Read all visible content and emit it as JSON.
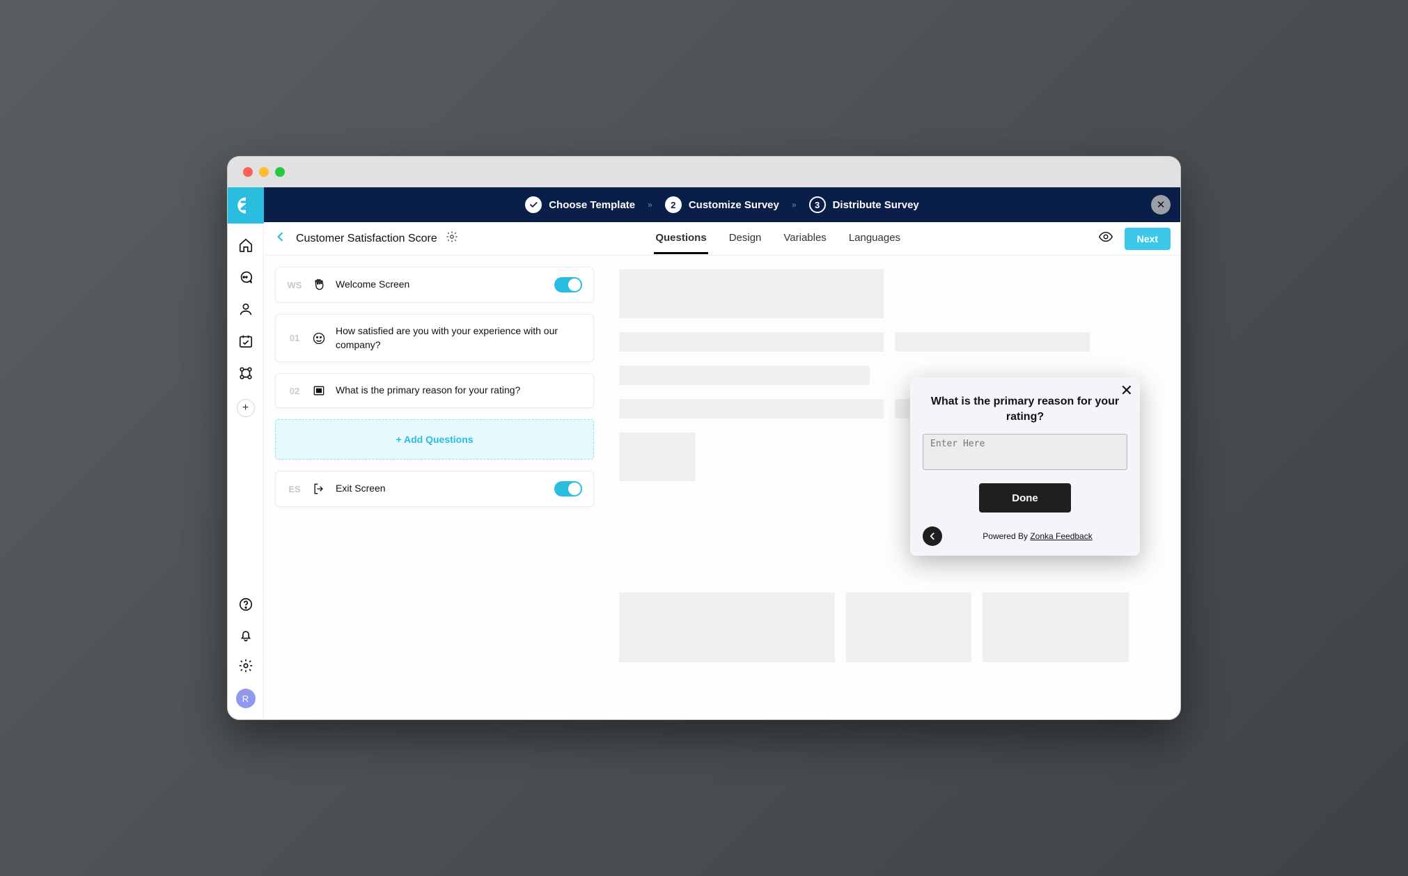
{
  "wizard": {
    "steps": [
      {
        "label": "Choose Template",
        "kind": "done"
      },
      {
        "label": "Customize Survey",
        "kind": "current",
        "num": "2"
      },
      {
        "label": "Distribute Survey",
        "kind": "pending",
        "num": "3"
      }
    ]
  },
  "header": {
    "title": "Customer Satisfaction Score",
    "tabs": [
      "Questions",
      "Design",
      "Variables",
      "Languages"
    ],
    "next_label": "Next"
  },
  "questions": {
    "welcome": {
      "tag": "WS",
      "label": "Welcome Screen",
      "toggle": true
    },
    "items": [
      {
        "num": "01",
        "label": "How satisfied are you with your experience with our company?"
      },
      {
        "num": "02",
        "label": "What is the primary reason for your rating?"
      }
    ],
    "add_label": "+ Add Questions",
    "exit": {
      "tag": "ES",
      "label": "Exit Screen",
      "toggle": true
    }
  },
  "popup": {
    "title": "What is the primary reason for your rating?",
    "placeholder": "Enter Here",
    "done": "Done",
    "powered_prefix": "Powered By ",
    "powered_brand": "Zonka Feedback"
  },
  "avatar": "R"
}
